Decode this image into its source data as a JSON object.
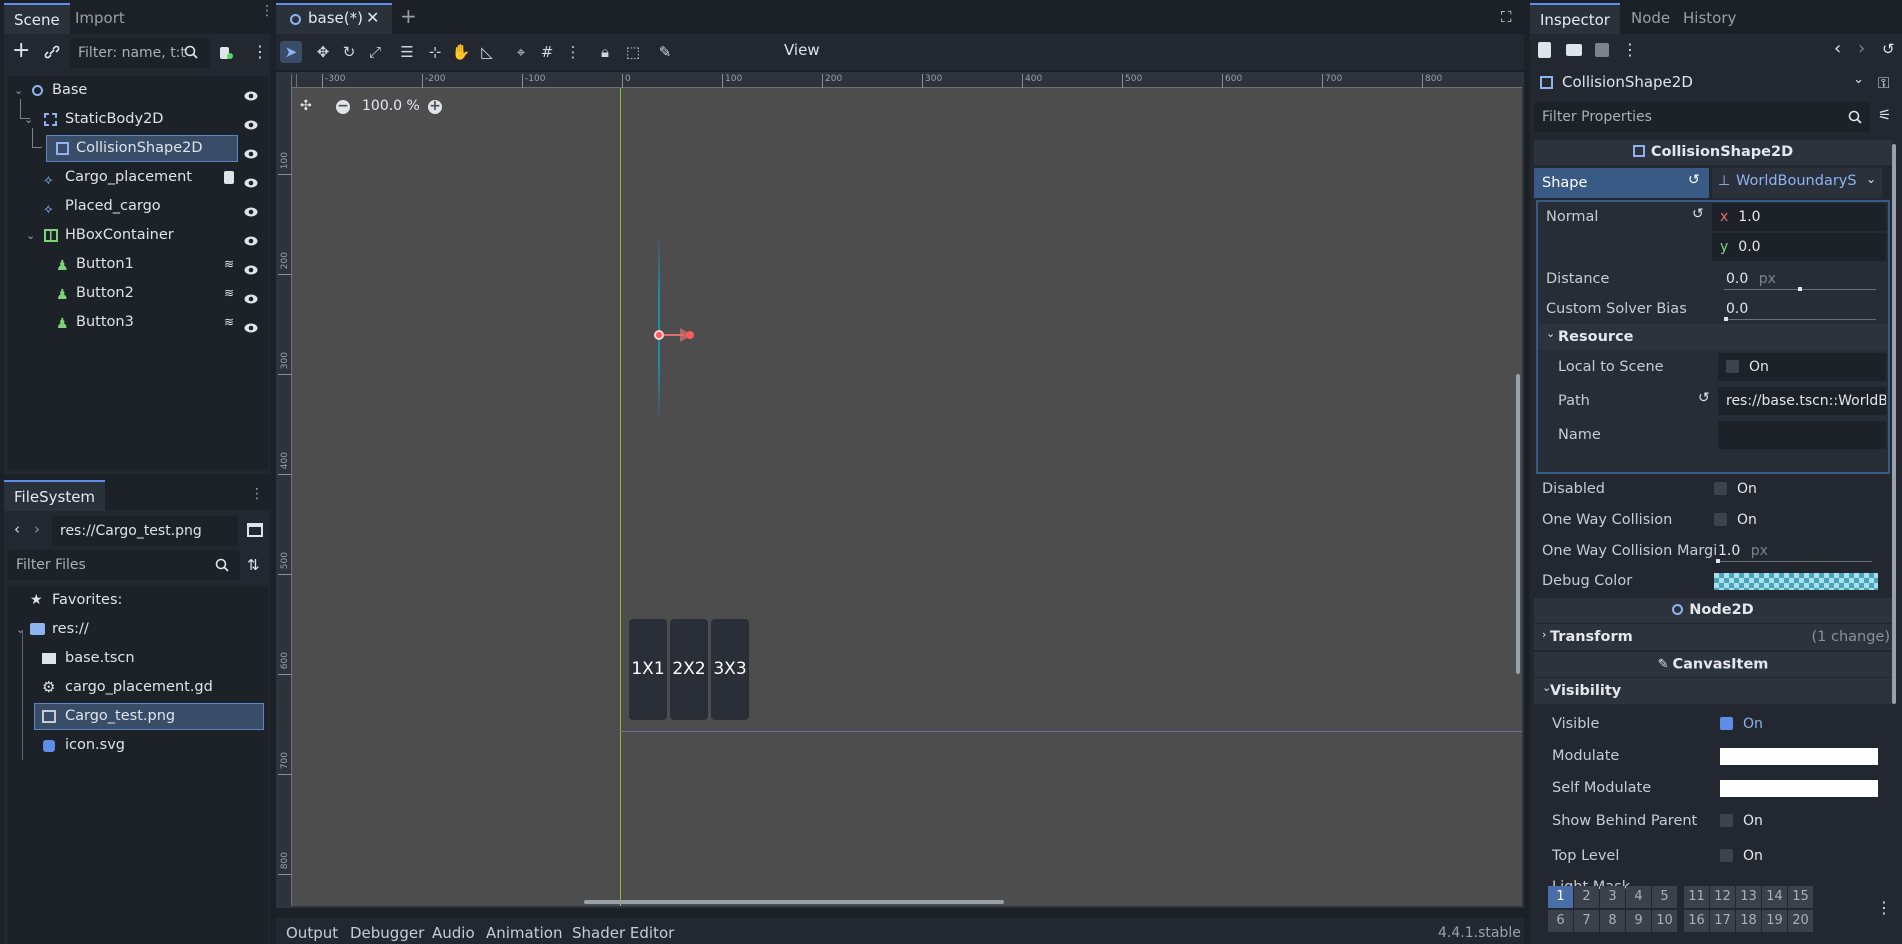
{
  "scene_panel": {
    "tabs": [
      "Scene",
      "Import"
    ],
    "filter_placeholder": "Filter: name, t:t",
    "tree": [
      {
        "label": "Base"
      },
      {
        "label": "StaticBody2D"
      },
      {
        "label": "CollisionShape2D"
      },
      {
        "label": "Cargo_placement"
      },
      {
        "label": "Placed_cargo"
      },
      {
        "label": "HBoxContainer"
      },
      {
        "label": "Button1"
      },
      {
        "label": "Button2"
      },
      {
        "label": "Button3"
      }
    ]
  },
  "filesystem": {
    "tab": "FileSystem",
    "path": "res://Cargo_test.png",
    "filter_placeholder": "Filter Files",
    "favorites": "Favorites:",
    "root": "res://",
    "files": [
      {
        "label": "base.tscn"
      },
      {
        "label": "cargo_placement.gd"
      },
      {
        "label": "Cargo_test.png"
      },
      {
        "label": "icon.svg"
      }
    ]
  },
  "editor": {
    "tab_title": "base(*)",
    "view_menu": "View",
    "zoom": "100.0 %",
    "ruler_top": [
      "-300",
      "-200",
      "-100",
      "0",
      "100",
      "200",
      "300",
      "400",
      "500",
      "600",
      "700",
      "800"
    ],
    "ruler_left": [
      "100",
      "200",
      "300",
      "400",
      "500",
      "600",
      "700",
      "800"
    ],
    "buttons": [
      "1X1",
      "2X2",
      "3X3"
    ]
  },
  "bottom_panel": {
    "tabs": [
      "Output",
      "Debugger",
      "Audio",
      "Animation",
      "Shader Editor"
    ],
    "version": "4.4.1.stable"
  },
  "inspector": {
    "tabs": [
      "Inspector",
      "Node",
      "History"
    ],
    "node_name": "CollisionShape2D",
    "filter_placeholder": "Filter Properties",
    "section_collision": "CollisionShape2D",
    "shape_label": "Shape",
    "shape_value": "WorldBoundaryS",
    "normal_label": "Normal",
    "normal_x": "1.0",
    "normal_y": "0.0",
    "x_axis": "x",
    "y_axis": "y",
    "distance_label": "Distance",
    "distance_value": "0.0",
    "px": "px",
    "bias_label": "Custom Solver Bias",
    "bias_value": "0.0",
    "resource_label": "Resource",
    "local_label": "Local to Scene",
    "on": "On",
    "path_label": "Path",
    "path_value": "res://base.tscn::WorldB",
    "name_label": "Name",
    "disabled_label": "Disabled",
    "oneway_label": "One Way Collision",
    "oneway_margin_label": "One Way Collision Margi",
    "oneway_margin_value": "1.0",
    "debug_color_label": "Debug Color",
    "section_node2d": "Node2D",
    "transform_label": "Transform",
    "transform_note": "(1 change)",
    "section_canvas": "CanvasItem",
    "visibility_label": "Visibility",
    "visible_label": "Visible",
    "modulate_label": "Modulate",
    "self_modulate_label": "Self Modulate",
    "show_behind_label": "Show Behind Parent",
    "top_level_label": "Top Level",
    "light_mask_label": "Light Mask",
    "light_mask_row1": [
      "1",
      "2",
      "3",
      "4",
      "5",
      "11",
      "12",
      "13",
      "14",
      "15"
    ],
    "light_mask_row2": [
      "6",
      "7",
      "8",
      "9",
      "10",
      "16",
      "17",
      "18",
      "19",
      "20"
    ]
  },
  "colors": {
    "accent": "#5d8ee8",
    "selection": "#3a4d68",
    "viewport": "#4d4d4d"
  }
}
